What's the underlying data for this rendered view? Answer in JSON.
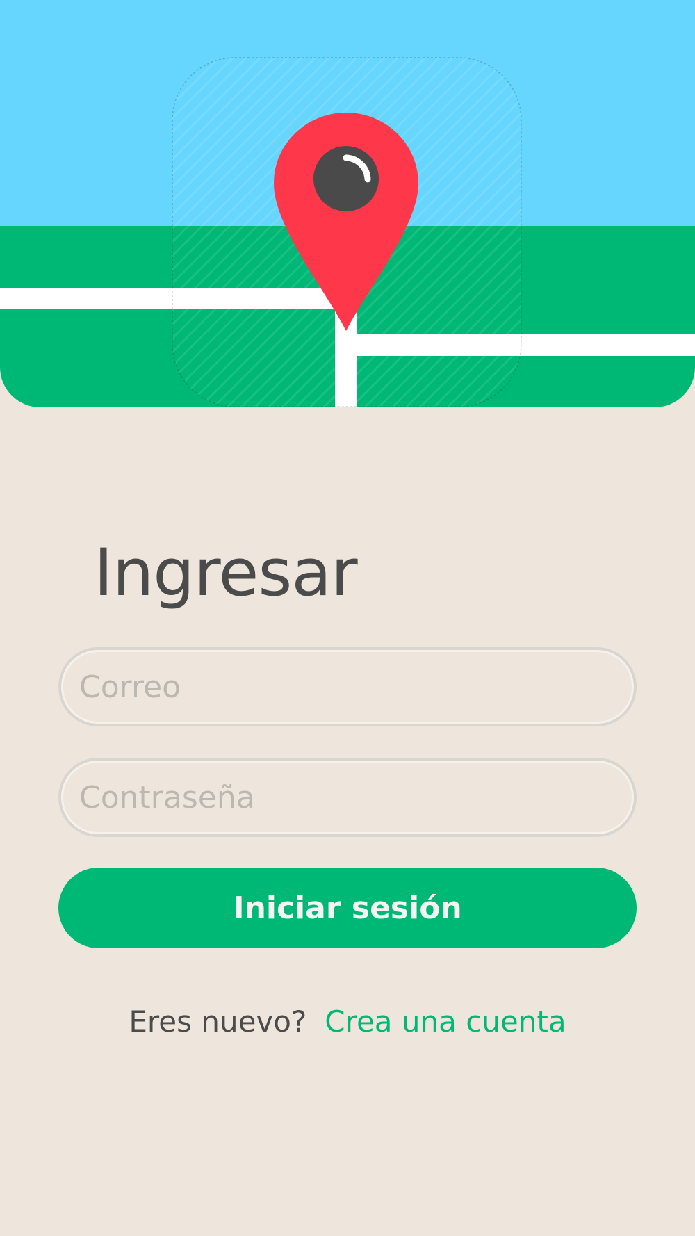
{
  "colors": {
    "sky": "#66D6FF",
    "grass": "#00B876",
    "road": "#FFFFFF",
    "pin": "#FF374B",
    "pin_dot": "#4A4A4A",
    "background": "#EEE6DC",
    "text_dark": "#4B4B4B",
    "accent": "#00B876",
    "placeholder": "#BDB7B1"
  },
  "header": {
    "illustration": "map-with-location-pin",
    "icon": "location-pin-icon"
  },
  "login": {
    "title": "Ingresar",
    "email_placeholder": "Correo",
    "email_value": "",
    "password_placeholder": "Contraseña",
    "password_value": "",
    "submit_label": "Iniciar sesión"
  },
  "signup": {
    "question": "Eres nuevo?",
    "link_label": "Crea una cuenta"
  }
}
